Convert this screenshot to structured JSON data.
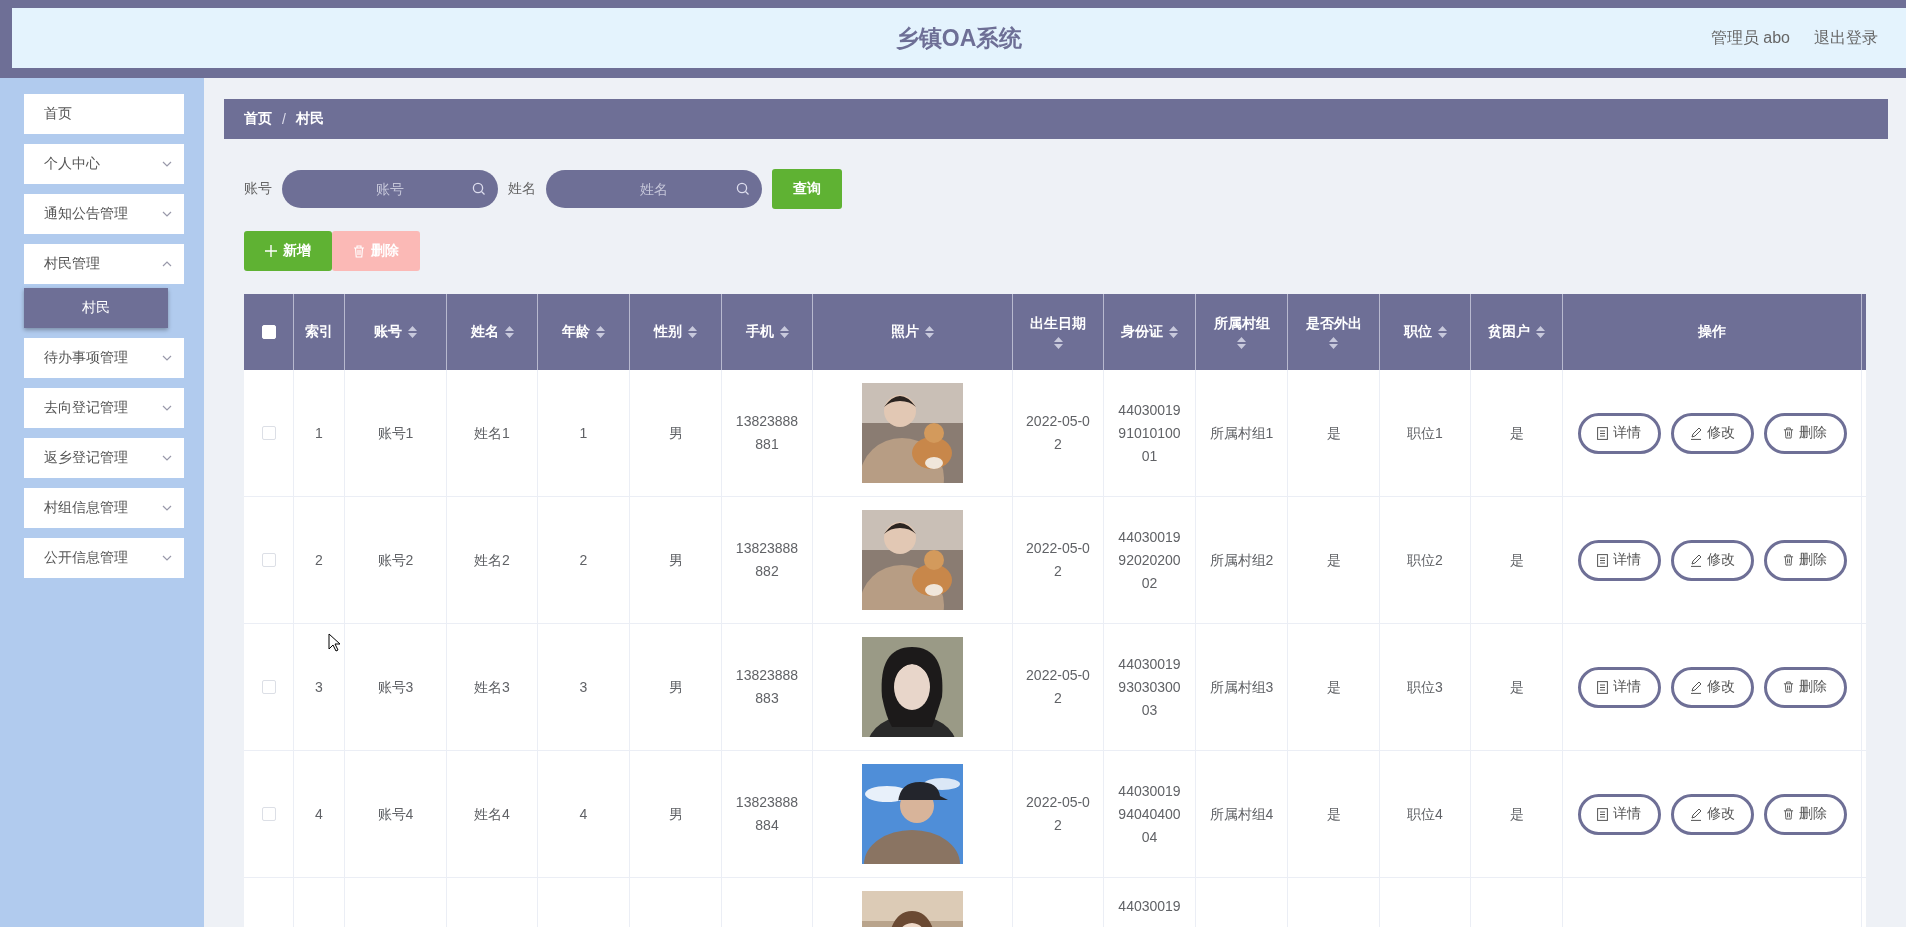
{
  "header": {
    "title": "乡镇OA系统",
    "user": "管理员 abo",
    "logout": "退出登录"
  },
  "sidebar": {
    "items": [
      {
        "label": "首页",
        "selected": false
      },
      {
        "label": "个人中心",
        "selected": false,
        "expanded": false
      },
      {
        "label": "通知公告管理",
        "selected": false,
        "expanded": false
      },
      {
        "label": "村民管理",
        "selected": false,
        "expanded": true,
        "children": [
          {
            "label": "村民",
            "selected": true
          }
        ]
      },
      {
        "label": "待办事项管理",
        "selected": false,
        "expanded": false
      },
      {
        "label": "去向登记管理",
        "selected": false,
        "expanded": false
      },
      {
        "label": "返乡登记管理",
        "selected": false,
        "expanded": false
      },
      {
        "label": "村组信息管理",
        "selected": false,
        "expanded": false
      },
      {
        "label": "公开信息管理",
        "selected": false,
        "expanded": false
      }
    ]
  },
  "breadcrumb": {
    "items": [
      "首页",
      "村民"
    ],
    "separator": "/"
  },
  "search": {
    "fields": [
      {
        "label": "账号",
        "placeholder": "账号"
      },
      {
        "label": "姓名",
        "placeholder": "姓名"
      }
    ],
    "button": "查询"
  },
  "toolbar": [
    {
      "kind": "add",
      "label": "新增",
      "disabled": false
    },
    {
      "kind": "delete",
      "label": "删除",
      "disabled": true
    }
  ],
  "table": {
    "select_all_checked": false,
    "columns": [
      {
        "kind": "text",
        "label": "索引",
        "sortable": false
      },
      {
        "kind": "text",
        "label": "账号",
        "sortable": true
      },
      {
        "kind": "text",
        "label": "姓名",
        "sortable": true
      },
      {
        "kind": "text",
        "label": "年龄",
        "sortable": true
      },
      {
        "kind": "text",
        "label": "性别",
        "sortable": true
      },
      {
        "kind": "text",
        "label": "手机",
        "sortable": true
      },
      {
        "label": "照片",
        "sortable": true
      },
      {
        "kind": "text",
        "label": "出生日期",
        "sortable": true
      },
      {
        "kind": "text",
        "label": "身份证",
        "sortable": true
      },
      {
        "kind": "text",
        "label": "所属村组",
        "sortable": true
      },
      {
        "kind": "text",
        "label": "是否外出",
        "sortable": true
      },
      {
        "kind": "text",
        "label": "职位",
        "sortable": true
      },
      {
        "kind": "text",
        "label": "贫困户",
        "sortable": true
      },
      {
        "kind": "actions",
        "label": "操作",
        "sortable": false
      }
    ],
    "rows": [
      {
        "checked": false,
        "cells": [
          "1",
          "账号1",
          "姓名1",
          "1",
          "男",
          "13823888881",
          {
            "kind": "picture"
          },
          "2022-05-02",
          "440300199101010001",
          "所属村组1",
          "是",
          "职位1",
          "是",
          [
            {
              "kind": "detail",
              "label": "详情"
            },
            {
              "kind": "edit",
              "label": "修改"
            },
            {
              "kind": "delete",
              "label": "删除"
            }
          ]
        ]
      },
      {
        "checked": false,
        "cells": [
          "2",
          "账号2",
          "姓名2",
          "2",
          "男",
          "13823888882",
          {
            "kind": "picture"
          },
          "2022-05-02",
          "440300199202020002",
          "所属村组2",
          "是",
          "职位2",
          "是",
          [
            {
              "kind": "detail",
              "label": "详情"
            },
            {
              "kind": "edit",
              "label": "修改"
            },
            {
              "kind": "delete",
              "label": "删除"
            }
          ]
        ]
      },
      {
        "checked": false,
        "cells": [
          "3",
          "账号3",
          "姓名3",
          "3",
          "男",
          "13823888883",
          {
            "kind": "picture"
          },
          "2022-05-02",
          "440300199303030003",
          "所属村组3",
          "是",
          "职位3",
          "是",
          [
            {
              "kind": "detail",
              "label": "详情"
            },
            {
              "kind": "edit",
              "label": "修改"
            },
            {
              "kind": "delete",
              "label": "删除"
            }
          ]
        ]
      },
      {
        "checked": false,
        "cells": [
          "4",
          "账号4",
          "姓名4",
          "4",
          "男",
          "13823888884",
          {
            "kind": "picture"
          },
          "2022-05-02",
          "440300199404040004",
          "所属村组4",
          "是",
          "职位4",
          "是",
          [
            {
              "kind": "detail",
              "label": "详情"
            },
            {
              "kind": "edit",
              "label": "修改"
            },
            {
              "kind": "delete",
              "label": "删除"
            }
          ]
        ]
      },
      {
        "cells": [
          "",
          "",
          "",
          "",
          "",
          "",
          {
            "kind": "picture"
          },
          "",
          "44030019"
        ]
      }
    ]
  }
}
